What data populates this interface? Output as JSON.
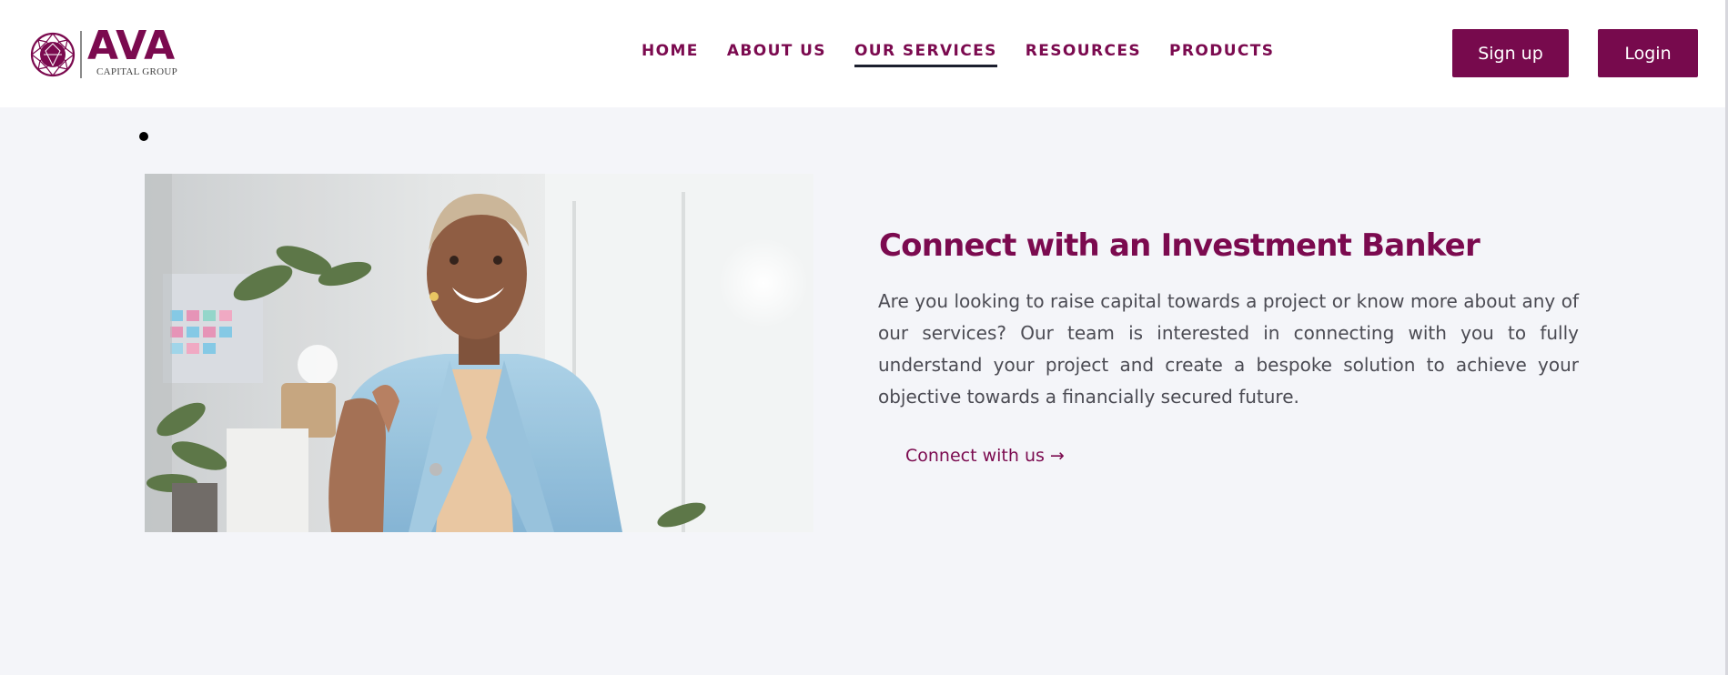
{
  "header": {
    "logo": {
      "brand": "AVA",
      "subtitle": "CAPITAL GROUP"
    },
    "nav": [
      {
        "label": "HOME"
      },
      {
        "label": "ABOUT US"
      },
      {
        "label": "OUR SERVICES",
        "active": true
      },
      {
        "label": "RESOURCES"
      },
      {
        "label": "PRODUCTS"
      }
    ],
    "signup_label": "Sign up",
    "login_label": "Login"
  },
  "main": {
    "image": {
      "icon": "photo-businesswoman-handshake"
    },
    "title": "Connect with an Investment Banker",
    "body": "Are you looking to raise capital towards a project or know more about any of our services? Our team is interested in connecting with you to fully understand your project and create a bespoke solution to achieve your objective towards a financially secured future.",
    "cta_label": "Connect with us →"
  },
  "colors": {
    "brand": "#7b0a4f",
    "button_bg": "#770a4d",
    "page_bg": "#f4f5f9",
    "body_text": "#4b4b53",
    "active_underline": "#1c1f2e"
  }
}
